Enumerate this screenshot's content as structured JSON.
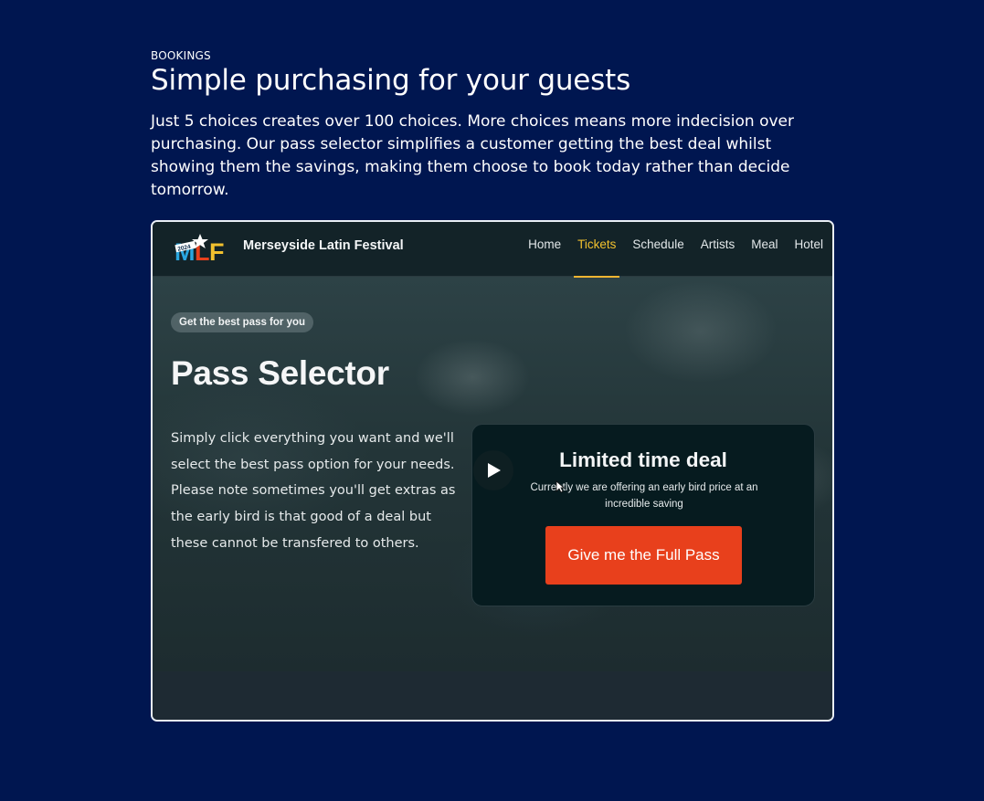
{
  "section": {
    "eyebrow": "BOOKINGS",
    "headline": "Simple purchasing for your guests",
    "description": "Just 5 choices creates over 100 choices. More choices means more indecision over purchasing. Our pass selector simplifies a customer getting the best deal whilst showing them the savings, making them choose to book today rather than decide tomorrow."
  },
  "screenshot": {
    "logo": {
      "text": "MLF",
      "year": "2024"
    },
    "site_name": "Merseyside Latin Festival",
    "nav": [
      "Home",
      "Tickets",
      "Schedule",
      "Artists",
      "Meal",
      "Hotel"
    ],
    "active_nav": "Tickets",
    "hero": {
      "pill": "Get the best pass for you",
      "title": "Pass Selector",
      "text": "Simply click everything you want and we'll select the best pass option for your needs. Please note sometimes you'll get extras as the early bird is that good of a deal but these cannot be transfered to others."
    },
    "deal": {
      "title": "Limited time deal",
      "subtitle": "Currently we are offering an early bird price at an incredible saving",
      "button": "Give me the Full Pass"
    }
  },
  "colors": {
    "page_background": "#001650",
    "accent_button": "#e8401c",
    "active_nav": "#f2c12e"
  },
  "icons": [
    "play-icon",
    "cursor-icon",
    "logo-star-icon"
  ]
}
